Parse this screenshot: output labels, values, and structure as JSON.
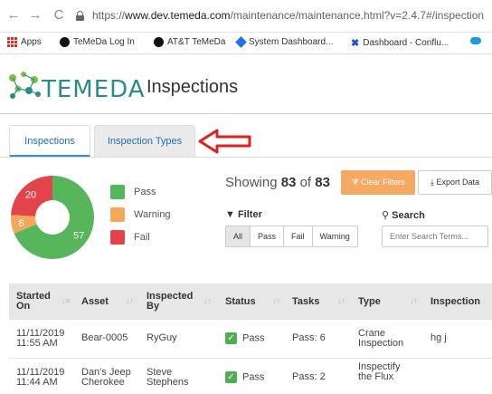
{
  "browser": {
    "url_prefix": "https://",
    "url_host": "www.dev.temeda.com",
    "url_path": "/maintenance/maintenance.html?v=2.4.7#/inspection",
    "bookmarks": [
      {
        "label": "Apps",
        "icon": "apps-grid-icon"
      },
      {
        "label": "TeMeDa Log In",
        "icon": "temeda-icon"
      },
      {
        "label": "AT&T TeMeDa",
        "icon": "temeda-icon"
      },
      {
        "label": "System Dashboard...",
        "icon": "diamond-icon"
      },
      {
        "label": "Dashboard - Conflu...",
        "icon": "confluence-icon"
      }
    ]
  },
  "header": {
    "logo_text": "TEMEDA",
    "page_title": "Inspections"
  },
  "tabs": [
    {
      "label": "Inspections",
      "active": true
    },
    {
      "label": "Inspection Types",
      "active": false
    }
  ],
  "summary": {
    "chart_data": {
      "type": "pie",
      "categories": [
        "Pass",
        "Warning",
        "Fail"
      ],
      "values": [
        57,
        6,
        20
      ],
      "colors": [
        "#57b55b",
        "#f4a95a",
        "#e3434b"
      ]
    },
    "legend": [
      {
        "label": "Pass",
        "color": "#57b55b"
      },
      {
        "label": "Warning",
        "color": "#f4a95a"
      },
      {
        "label": "Fail",
        "color": "#e3434b"
      }
    ]
  },
  "results": {
    "showing_prefix": "Showing",
    "shown_count": "83",
    "of_word": "of",
    "total_count": "83",
    "clear_filters_label": "Clear Filters",
    "export_label": "Export Data"
  },
  "filter": {
    "label": "Filter",
    "options": [
      "All",
      "Pass",
      "Fail",
      "Warning"
    ],
    "selected": "All"
  },
  "search": {
    "label": "Search",
    "placeholder": "Enter Search Terms..."
  },
  "table": {
    "columns": [
      "Started On",
      "Asset",
      "Inspected By",
      "Status",
      "Tasks",
      "Type",
      "Inspection"
    ],
    "rows": [
      {
        "started_date": "11/11/2019",
        "started_time": "11:55 AM",
        "asset": "Bear-0005",
        "asset_line2": "",
        "inspected_by": "RyGuy",
        "inspected_by_line2": "",
        "status": "Pass",
        "tasks": "Pass: 6",
        "type": "Crane",
        "type_line2": "Inspection",
        "inspection": "hg j"
      },
      {
        "started_date": "11/11/2019",
        "started_time": "11:44 AM",
        "asset": "Dan's Jeep",
        "asset_line2": "Cherokee",
        "inspected_by": "Steve",
        "inspected_by_line2": "Stephens",
        "status": "Pass",
        "tasks": "Pass: 2",
        "type": "Inspectify",
        "type_line2": "the Flux",
        "inspection": ""
      }
    ]
  },
  "colors": {
    "accent_blue": "#1f6fb2",
    "clear_button": "#f6a962",
    "arrow_red": "#e02020",
    "logo_teal": "#2d8a8a"
  }
}
